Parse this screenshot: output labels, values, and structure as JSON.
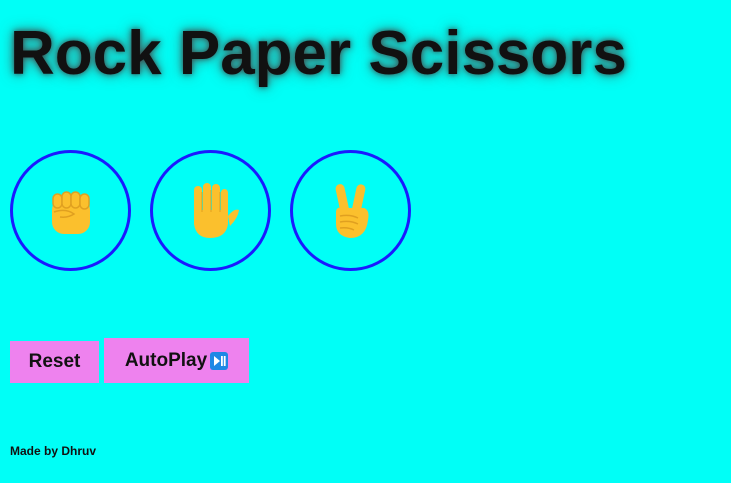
{
  "header": {
    "title": "Rock Paper Scissors"
  },
  "moves": [
    {
      "name": "rock",
      "icon": "raised-fist-icon"
    },
    {
      "name": "paper",
      "icon": "raised-hand-icon"
    },
    {
      "name": "scissors",
      "icon": "victory-hand-icon"
    }
  ],
  "controls": {
    "reset_label": "Reset",
    "autoplay_label": "AutoPlay",
    "autoplay_icon": "play-pause-icon"
  },
  "footer": {
    "credit": "Made by Dhruv"
  },
  "colors": {
    "background": "#00fff7",
    "move_border": "#1a1aff",
    "button_bg": "#ee82ee",
    "emoji": "#fbc02d"
  }
}
